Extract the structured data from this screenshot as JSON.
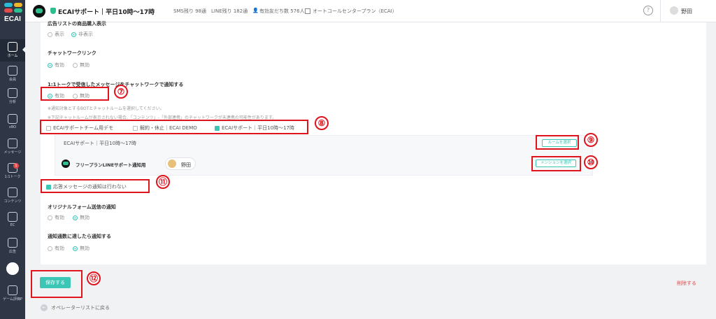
{
  "sidebar": {
    "logo": "ECAI",
    "logo_colors": [
      "#2bbad6",
      "#f0b429",
      "#e24b4b",
      "#2dbf8f"
    ],
    "items": [
      {
        "label": "ホーム",
        "icon": "home-icon"
      },
      {
        "label": "会員",
        "icon": "members-icon"
      },
      {
        "label": "分析",
        "icon": "analytics-icon"
      },
      {
        "label": "xBO",
        "icon": "bot-icon"
      },
      {
        "label": "メッセージ",
        "icon": "message-icon"
      },
      {
        "label": "1:1トーク",
        "icon": "talk-icon",
        "badge": "1"
      },
      {
        "label": "コンテンツ",
        "icon": "contents-icon"
      },
      {
        "label": "EC",
        "icon": "cart-icon"
      },
      {
        "label": "広告",
        "icon": "megaphone-icon"
      },
      {
        "label": "",
        "icon": "shopify-icon"
      },
      {
        "label": "ゲーム評価P",
        "icon": "game-icon"
      }
    ]
  },
  "topbar": {
    "account_name": "ECAIサポート｜平日10時〜17時",
    "sms": "SMS残り 98通",
    "line": "LINE残り 182通",
    "friends": "有効友だち数 576人",
    "plan": "オートコールセンタープラン（ECAI）",
    "help": "?",
    "user": "野田"
  },
  "form": {
    "ad_list_label": "広告リストの商品購入表示",
    "ad_list_options": [
      "表示",
      "非表示"
    ],
    "chatwork_label": "チャットワークリンク",
    "chatwork_options": [
      "有効",
      "無効"
    ],
    "notify_label": "1:1トークで受信したメッセージをチャットワークで通知する",
    "notify_options": [
      "有効",
      "無効"
    ],
    "note1": "※通知対象とするBOTとチャットルームを選択してください。",
    "note2": "※下記チャットルームが表示されない場合、「コンテンツ」-「外部連携」のチャットワークが未連携の可能性があります。",
    "bot_checks": [
      "ECAIサポートチーム用デモ",
      "解約・休止｜ECAI DEMO",
      "ECAIサポート｜平日10時〜17時"
    ],
    "sub_title": "ECAIサポート｜平日10時〜17時",
    "room_button": "ルームを選択",
    "room_name": "フリープランLINEサポート通知用",
    "mention_user": "野田",
    "mention_button": "メンションを選択",
    "no_reply_label": "応答メッセージの通知は行わない",
    "form_notify_label": "オリジナルフォーム送信の通知",
    "form_notify_options": [
      "有効",
      "無効"
    ],
    "limit_notify_label": "通知通数に達したら通知する",
    "limit_notify_options": [
      "有効",
      "無効"
    ]
  },
  "footer": {
    "save": "保存する",
    "delete": "削除する",
    "back": "オペレーターリストに戻る"
  },
  "annotations": [
    "⑦",
    "⑧",
    "⑨",
    "⑩",
    "⑪",
    "⑫"
  ],
  "colors": {
    "accent": "#3cc6b6",
    "highlight": "#e0141d",
    "sidebar": "#2f3747"
  }
}
